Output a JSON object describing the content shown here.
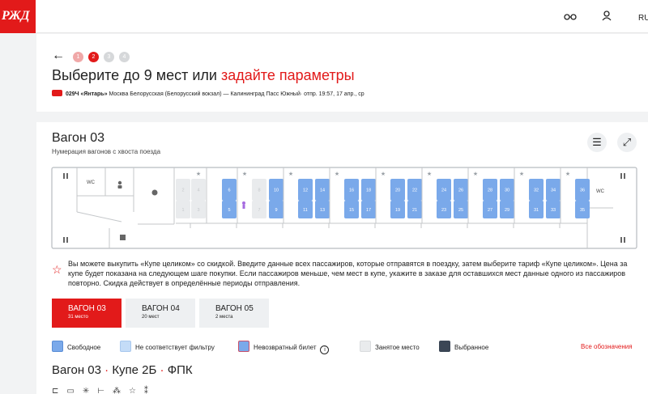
{
  "header": {
    "logo_text": "РЖД",
    "lang": "RU"
  },
  "stepper": {
    "steps": [
      "1",
      "2",
      "3",
      "4"
    ],
    "active": 2
  },
  "page": {
    "title_main": "Выберите до 9 мест или ",
    "title_link": "задайте параметры",
    "train_number": "029Ч «Янтарь»",
    "route_text": " Москва Белорусская (Белорусский вокзал) — Калининград Пасс Южный·  отпр. 19:57, 17 апр., ср"
  },
  "wagon": {
    "title": "Вагон 03",
    "subtitle": "Нумерация вагонов с хвоста поезда",
    "wc_label_left": "WC",
    "wc_label_right": "WC",
    "seats_top": [
      {
        "n": "2",
        "s": "occupied"
      },
      {
        "n": "4",
        "s": "occupied"
      },
      {
        "n": "6",
        "s": "free"
      },
      {
        "n": "8",
        "s": "occupied"
      },
      {
        "n": "10",
        "s": "free"
      },
      {
        "n": "12",
        "s": "free"
      },
      {
        "n": "14",
        "s": "free"
      },
      {
        "n": "16",
        "s": "free"
      },
      {
        "n": "18",
        "s": "free"
      },
      {
        "n": "20",
        "s": "free"
      },
      {
        "n": "22",
        "s": "free"
      },
      {
        "n": "24",
        "s": "free"
      },
      {
        "n": "26",
        "s": "free"
      },
      {
        "n": "28",
        "s": "free"
      },
      {
        "n": "30",
        "s": "free"
      },
      {
        "n": "32",
        "s": "free"
      },
      {
        "n": "34",
        "s": "free"
      },
      {
        "n": "36",
        "s": "free"
      }
    ],
    "seats_bottom": [
      {
        "n": "1",
        "s": "occupied"
      },
      {
        "n": "3",
        "s": "occupied"
      },
      {
        "n": "5",
        "s": "free"
      },
      {
        "n": "7",
        "s": "occupied"
      },
      {
        "n": "9",
        "s": "free"
      },
      {
        "n": "11",
        "s": "free"
      },
      {
        "n": "13",
        "s": "free"
      },
      {
        "n": "15",
        "s": "free"
      },
      {
        "n": "17",
        "s": "free"
      },
      {
        "n": "19",
        "s": "free"
      },
      {
        "n": "21",
        "s": "free"
      },
      {
        "n": "23",
        "s": "free"
      },
      {
        "n": "25",
        "s": "free"
      },
      {
        "n": "27",
        "s": "free"
      },
      {
        "n": "29",
        "s": "free"
      },
      {
        "n": "31",
        "s": "free"
      },
      {
        "n": "33",
        "s": "free"
      },
      {
        "n": "35",
        "s": "free"
      }
    ]
  },
  "info": {
    "text": "Вы можете выкупить «Купе целиком» со скидкой. Введите данные всех пассажиров, которые отправятся в поездку, затем выберите тариф «Купе целиком». Цена за купе будет показана на следующем шаге покупки. Если пассажиров меньше, чем мест в купе, укажите в заказе для оставшихся мест данные одного из пассажиров повторно. Скидка действует в определённые периоды отправления."
  },
  "tabs": [
    {
      "label": "ВАГОН 03",
      "count": "31 место",
      "active": true
    },
    {
      "label": "ВАГОН 04",
      "count": "20 мест",
      "active": false
    },
    {
      "label": "ВАГОН 05",
      "count": "2 места",
      "active": false
    }
  ],
  "legend": {
    "free": "Свободное",
    "not_matching": "Не соответствует фильтру",
    "nonrefundable": "Невозвратный билет",
    "occupied": "Занятое место",
    "selected": "Выбранное",
    "all_link": "Все обозначения"
  },
  "section": {
    "wagon": "Вагон 03",
    "compartment": "Купе 2Б",
    "carrier": "ФПК",
    "sep": "·"
  },
  "colors": {
    "brand": "#e21a1a",
    "free": "#7aa9ea",
    "occupied": "#e9ebed",
    "selected": "#3b4655",
    "not_matching": "#c4dcf7"
  }
}
